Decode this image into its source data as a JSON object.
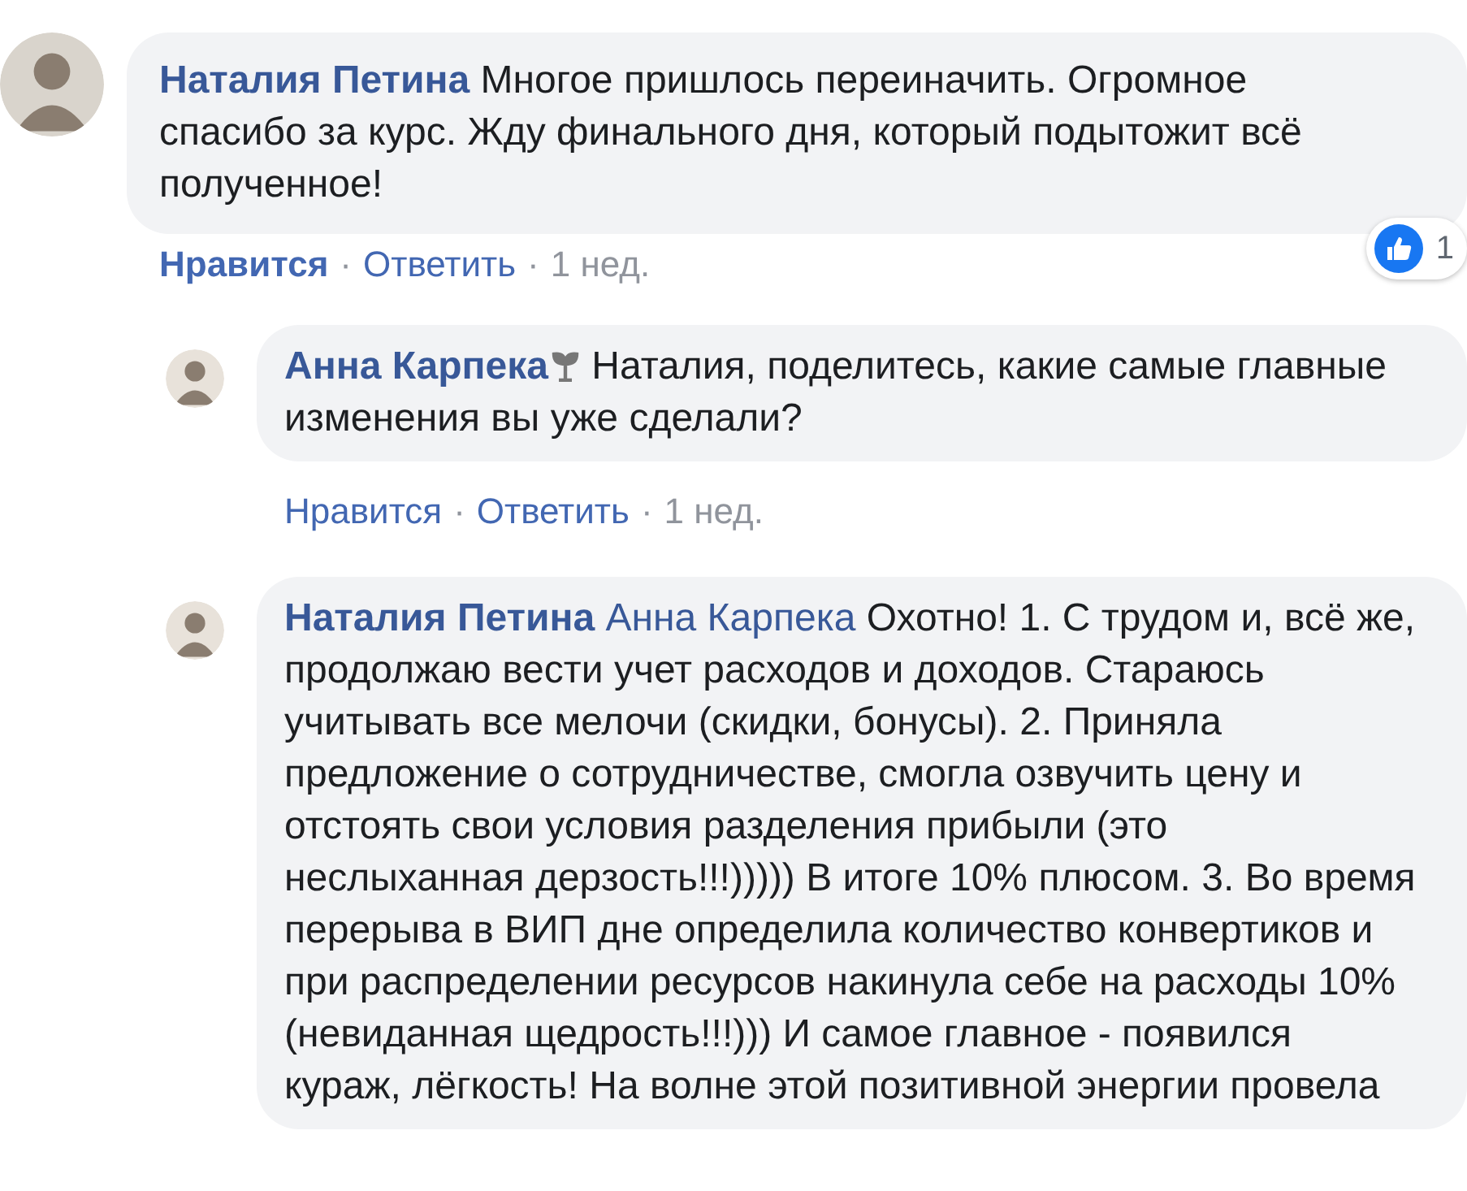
{
  "comments": [
    {
      "author": "Наталия Петина",
      "author_badge": false,
      "text": "Многое пришлось переиначить. Огромное спасибо за курс. Жду финального дня, который подытожит всё полученное!",
      "liked": true,
      "actions": {
        "like": "Нравится",
        "separator_1": "·",
        "reply": "Ответить",
        "separator_2": "·",
        "time": "1 нед."
      },
      "reactions": {
        "count": "1"
      },
      "children": [
        {
          "author": "Анна Карпека",
          "author_badge": true,
          "text": "Наталия, поделитесь, какие самые главные изменения вы уже сделали?",
          "liked": false,
          "actions": {
            "like": "Нравится",
            "separator_1": "·",
            "reply": "Ответить",
            "separator_2": "·",
            "time": "1 нед."
          }
        },
        {
          "author": "Наталия Петина",
          "author_badge": false,
          "mention": "Анна Карпека",
          "text": "Охотно! 1. С трудом и, всё же, продолжаю вести учет расходов и доходов. Стараюсь учитывать все мелочи (скидки, бонусы). 2. Приняла предложение о сотрудничестве, смогла озвучить цену и отстоять свои условия разделения прибыли (это неслыханная дерзость!!!))))) В итоге 10% плюсом. 3. Во время перерыва в ВИП дне определила количество конвертиков и при распределении ресурсов накинула себе на расходы 10% (невиданная щедрость!!!))) И самое главное - появился кураж, лёгкость! На волне этой позитивной энергии провела"
        }
      ]
    }
  ]
}
